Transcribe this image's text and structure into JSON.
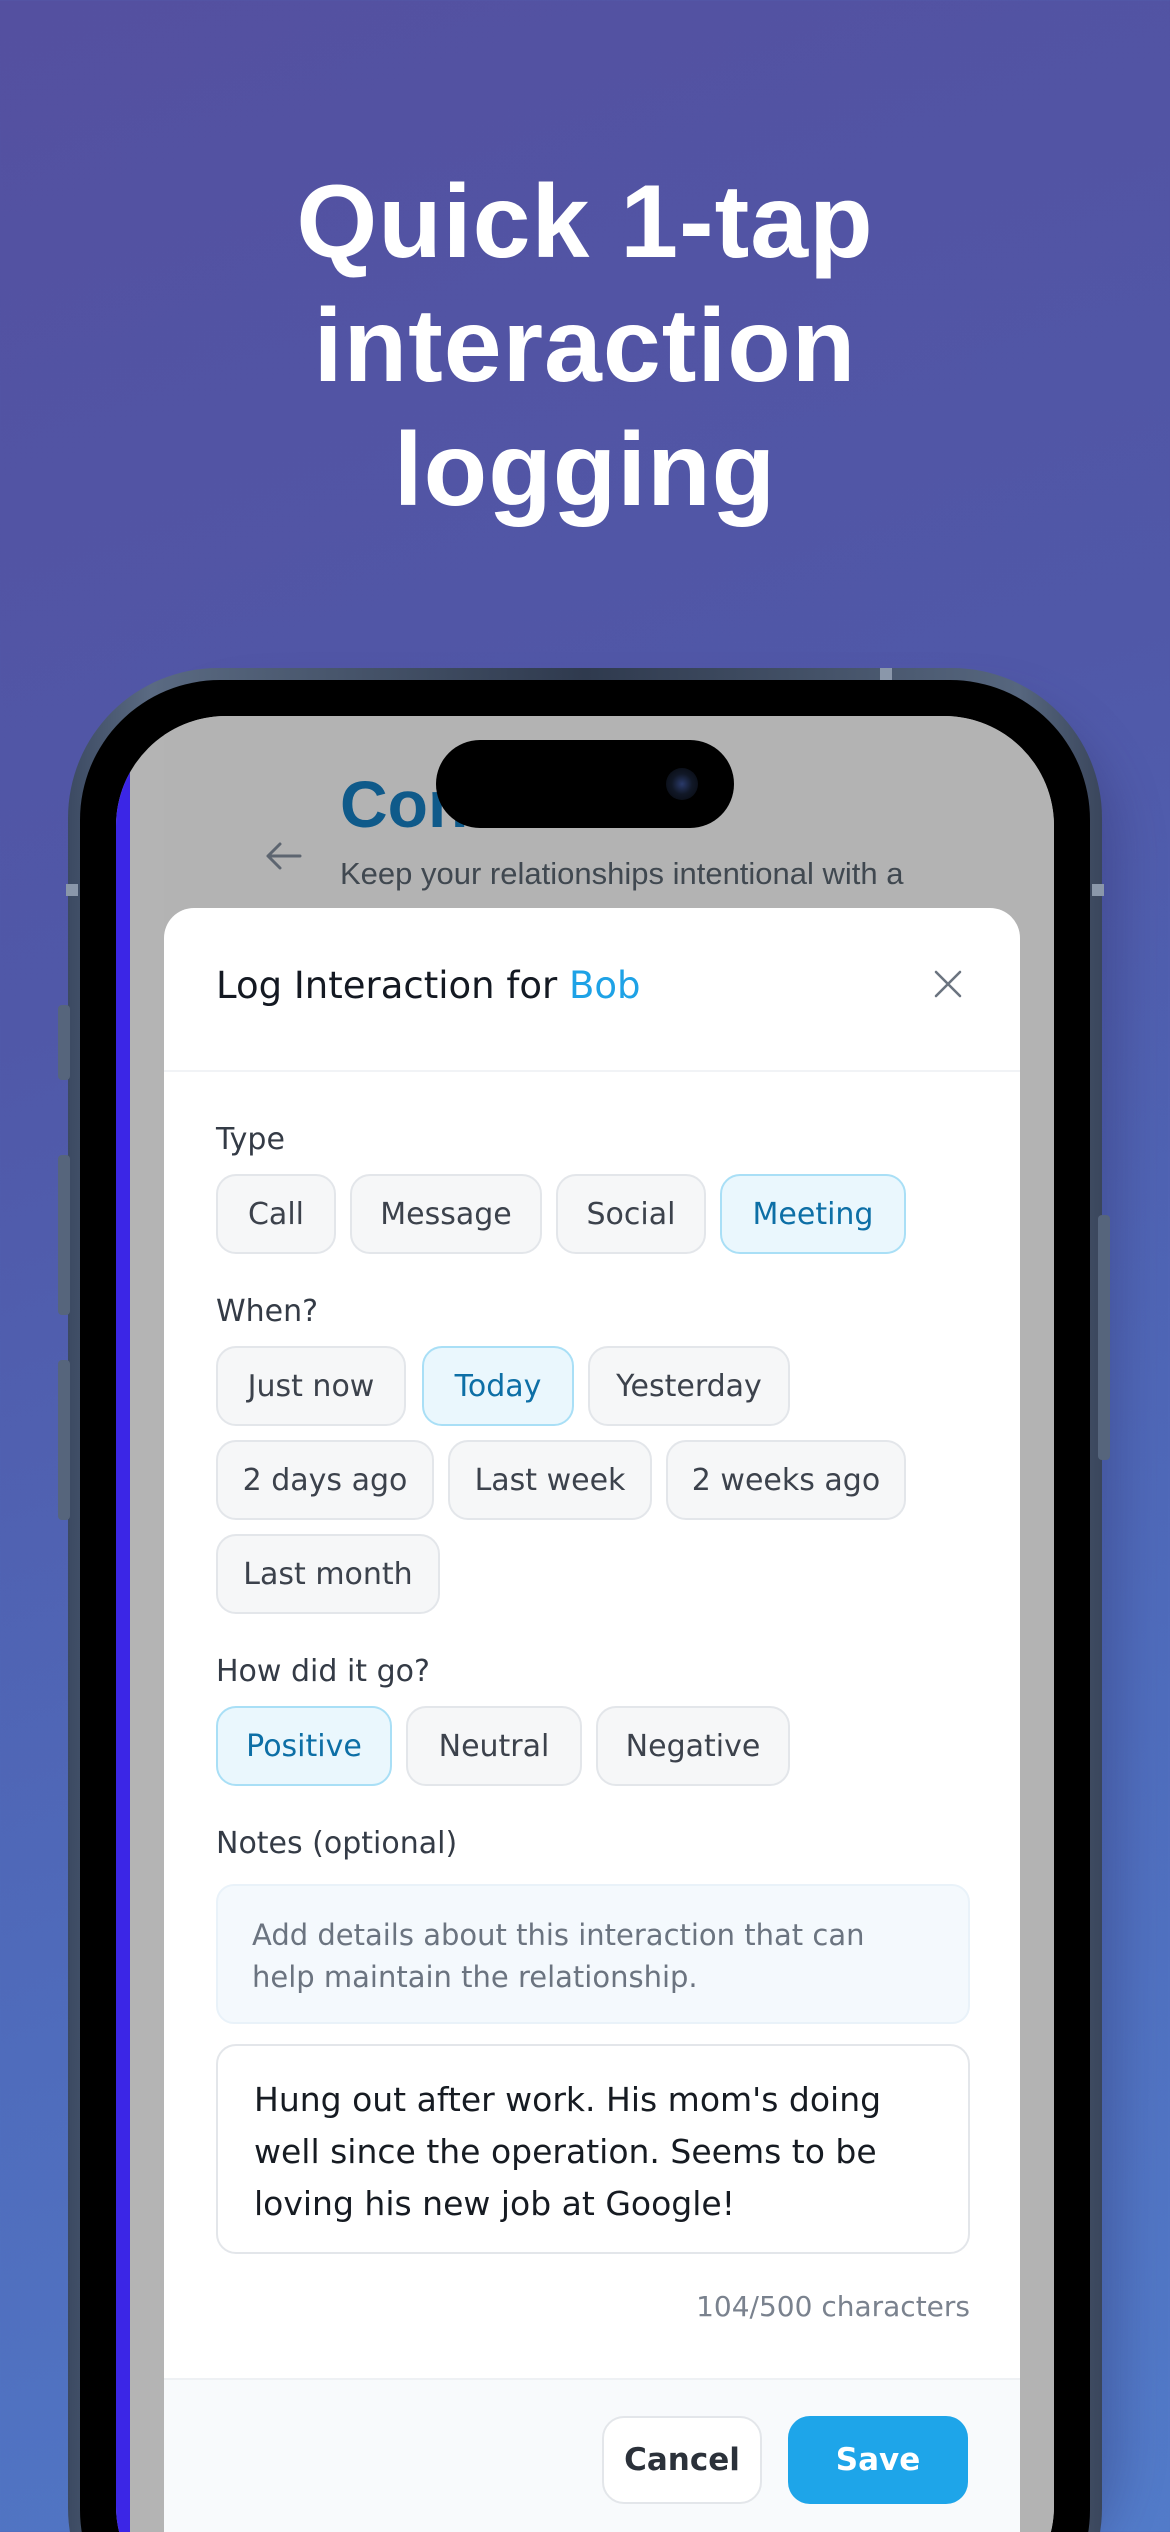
{
  "headline": "Quick 1-tap\ninteraction\nlogging",
  "background_screen": {
    "title": "Cont",
    "subtitle": "Keep your relationships intentional with a"
  },
  "modal": {
    "title_prefix": "Log Interaction for",
    "contact_name": "Bob",
    "type": {
      "label": "Type",
      "options": [
        "Call",
        "Message",
        "Social",
        "Meeting"
      ],
      "selected": "Meeting"
    },
    "when": {
      "label": "When?",
      "options": [
        "Just now",
        "Today",
        "Yesterday",
        "2 days ago",
        "Last week",
        "2 weeks ago",
        "Last month"
      ],
      "selected": "Today"
    },
    "sentiment": {
      "label": "How did it go?",
      "options": [
        "Positive",
        "Neutral",
        "Negative"
      ],
      "selected": "Positive"
    },
    "notes": {
      "label": "Notes (optional)",
      "hint": "Add details about this interaction that can help maintain the relationship.",
      "value": "Hung out after work. His mom's doing well since the operation. Seems to be loving his new job at Google!",
      "counter": "104/500 characters"
    },
    "buttons": {
      "cancel": "Cancel",
      "save": "Save"
    }
  },
  "colors": {
    "accent": "#1ea5e9",
    "active_chip_bg": "#eaf7fd",
    "active_chip_text": "#0d6fa6",
    "bg_title": "#0f5a8a"
  },
  "icons": [
    "back-arrow-icon",
    "close-icon",
    "camera-icon"
  ]
}
